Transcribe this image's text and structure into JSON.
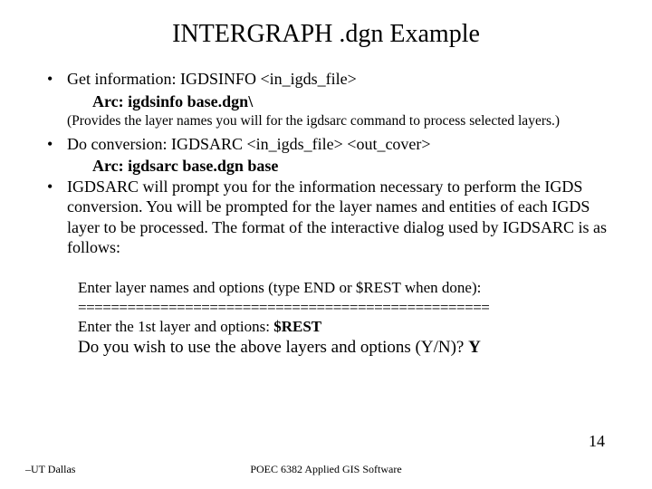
{
  "title": "INTERGRAPH .dgn Example",
  "bullets": {
    "b1_text": "Get information:  IGDSINFO <in_igds_file>",
    "b1_cmd": "Arc: igdsinfo  base.dgn\\",
    "b1_note": "(Provides the layer names you will for the igdsarc command to process selected layers.)",
    "b2_text": "Do conversion:  IGDSARC  <in_igds_file>  <out_cover>",
    "b2_cmd": "Arc: igdsarc  base.dgn  base",
    "b3_text": "IGDSARC will prompt you for the information necessary to perform the IGDS conversion.  You will be prompted for the layer names and entities of each IGDS layer to be processed.  The format of the interactive dialog used by IGDSARC is as follows:"
  },
  "dialog": {
    "l1": "Enter layer names and options (type END or $REST when done):",
    "sep": "==================================================",
    "l2a": "Enter the 1st layer and options:  ",
    "l2b": "$REST",
    "l3a": "Do you wish to use the above layers and options (Y/N)? ",
    "l3b": "Y"
  },
  "footer": {
    "left": "–UT Dallas",
    "center": "POEC 6382 Applied GIS Software",
    "page": "14"
  }
}
